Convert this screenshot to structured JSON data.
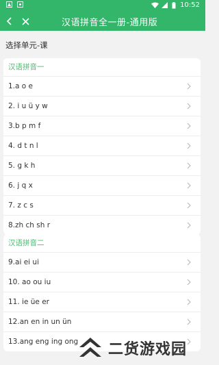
{
  "status_bar": {
    "time": "10:52"
  },
  "app_bar": {
    "title": "汉语拼音全一册-通用版"
  },
  "page": {
    "section_title": "选择单元-课"
  },
  "units": [
    {
      "title": "汉语拼音一",
      "lessons": [
        "1.a o e",
        "2. i u ü y w",
        "3.b p m f",
        "4. d t n l",
        "5. g k h",
        "6. j q x",
        "7. z c s",
        "8.zh ch sh r"
      ]
    },
    {
      "title": "汉语拼音二",
      "lessons": [
        "9.ai ei ui",
        "10. ao ou iu",
        "11. ie üe er",
        "12.an en in un ün",
        "13.ang eng ing ong"
      ]
    }
  ],
  "watermark": {
    "text": "二货游戏园"
  }
}
